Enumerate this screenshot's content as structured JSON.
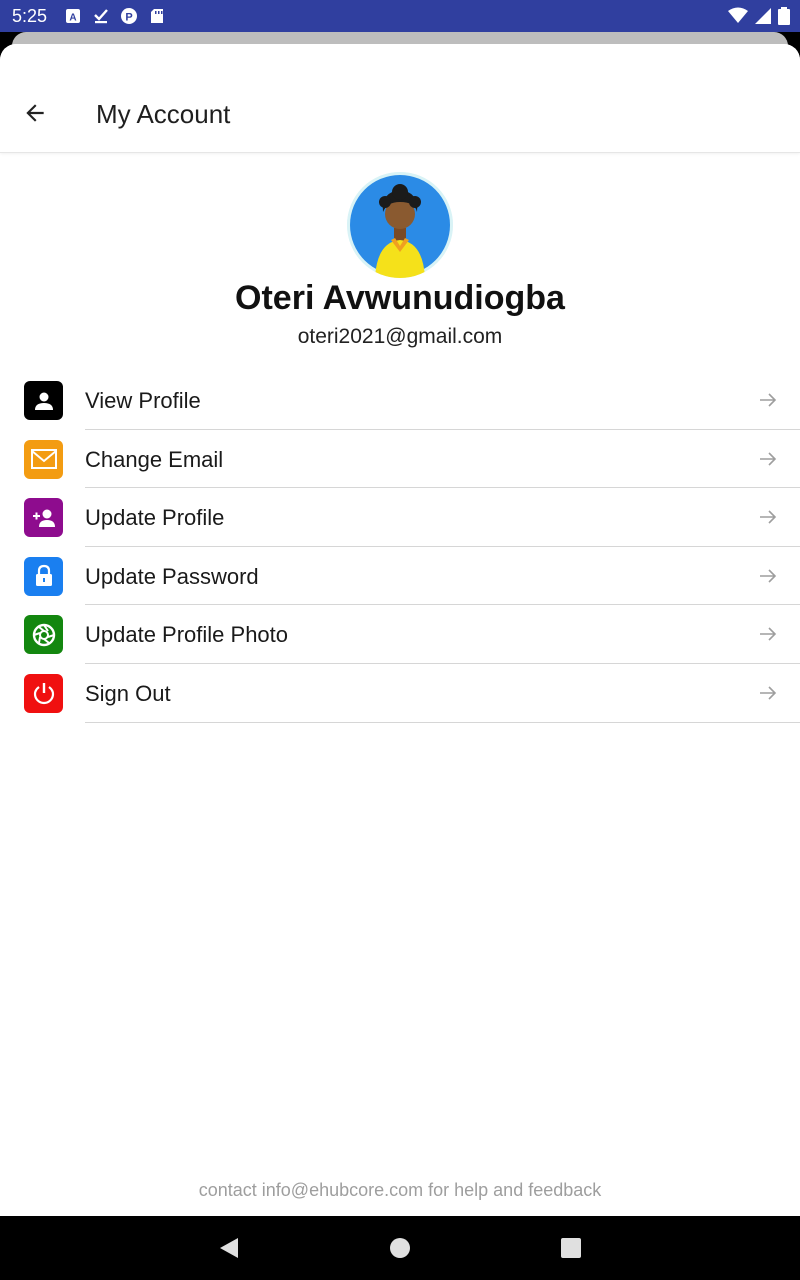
{
  "status_bar": {
    "time": "5:25",
    "left_icons": [
      "text-a-icon",
      "check-download-icon",
      "p-circle-icon",
      "sd-card-icon"
    ],
    "right_icons": [
      "wifi-icon",
      "signal-icon",
      "battery-icon"
    ]
  },
  "header": {
    "title": "My Account",
    "back_icon": "arrow-left-icon"
  },
  "profile": {
    "name": "Oteri Avwunudiogba",
    "email": "oteri2021@gmail.com"
  },
  "menu": {
    "items": [
      {
        "label": "View Profile",
        "icon": "person-icon",
        "color": "#000000"
      },
      {
        "label": "Change Email",
        "icon": "envelope-icon",
        "color": "#f39c12"
      },
      {
        "label": "Update Profile",
        "icon": "person-add-icon",
        "color": "#8e0c8e"
      },
      {
        "label": "Update Password",
        "icon": "lock-icon",
        "color": "#1a7ff0"
      },
      {
        "label": "Update Profile Photo",
        "icon": "camera-aperture-icon",
        "color": "#13870f"
      },
      {
        "label": "Sign Out",
        "icon": "power-icon",
        "color": "#f01010"
      }
    ]
  },
  "footer": {
    "note": "contact info@ehubcore.com for help and feedback"
  },
  "colors": {
    "status_bar": "#303f9f",
    "divider": "#d6d6d6",
    "footer_text": "#9e9e9e"
  }
}
